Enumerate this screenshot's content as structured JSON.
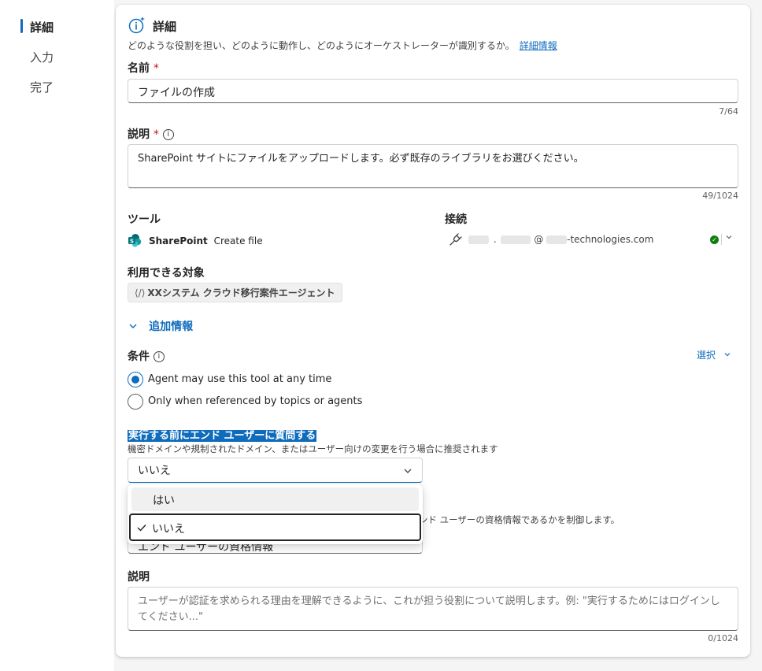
{
  "nav": {
    "items": [
      {
        "label": "詳細",
        "active": true
      },
      {
        "label": "入力",
        "active": false
      },
      {
        "label": "完了",
        "active": false
      }
    ]
  },
  "details": {
    "title": "詳細",
    "description": "どのような役割を担い、どのように動作し、どのようにオーケストレーターが識別するか。",
    "learn_more": "詳細情報"
  },
  "name_field": {
    "label": "名前",
    "required_mark": "*",
    "value": "ファイルの作成",
    "counter": "7/64"
  },
  "description_field": {
    "label": "説明",
    "required_mark": "*",
    "value": "SharePoint サイトにファイルをアップロードします。必ず既存のライブラリをお選びください。",
    "counter": "49/1024"
  },
  "tool": {
    "label": "ツール",
    "app": "SharePoint",
    "action": "Create file"
  },
  "connection": {
    "label": "接続",
    "account_at": "@",
    "account_domain": "-technologies.com",
    "status_color": "#107c10"
  },
  "availability": {
    "label": "利用できる対象",
    "agent_chip": "XXシステム クラウド移行案件エージェント"
  },
  "additional_info": {
    "label": "追加情報"
  },
  "conditions": {
    "label": "条件",
    "select_label": "選択",
    "options": [
      {
        "label": "Agent may use this tool at any time",
        "checked": true
      },
      {
        "label": "Only when referenced by topics or agents",
        "checked": false
      }
    ]
  },
  "ask_user": {
    "label": "実行する前にエンド ユーザーに質問する",
    "hint": "機密ドメインや規制されたドメイン、またはユーザー向けの変更を行う場合に推奨されます",
    "selected": "いいえ",
    "dropdown_options": [
      {
        "label": "はい",
        "selected": false
      },
      {
        "label": "いいえ",
        "selected": true
      }
    ]
  },
  "credentials": {
    "hint_partial": "ンド ユーザーの資格情報であるかを制御します。",
    "select_value_partial": "エンド ユーザーの資格情報"
  },
  "auth_description": {
    "label": "説明",
    "placeholder": "ユーザーが認証を求められる理由を理解できるように、これが担う役割について説明します。例: \"実行するためにはログインしてください...\"",
    "counter": "0/1024"
  },
  "colors": {
    "accent": "#0f6cbd",
    "required": "#c50f1f",
    "success": "#107c10"
  }
}
